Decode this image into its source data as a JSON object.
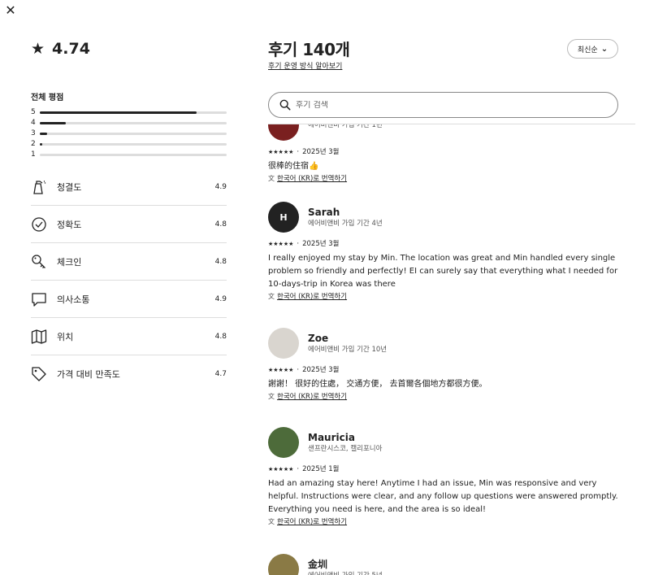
{
  "close_icon": "close-icon",
  "summary": {
    "score": "4.74",
    "overall_label": "전체 평점",
    "distribution": [
      {
        "stars": "5",
        "fraction": 0.84
      },
      {
        "stars": "4",
        "fraction": 0.14
      },
      {
        "stars": "3",
        "fraction": 0.04
      },
      {
        "stars": "2",
        "fraction": 0.01
      },
      {
        "stars": "1",
        "fraction": 0.0
      }
    ],
    "categories": [
      {
        "icon": "cleaning-spray-icon",
        "label": "청결도",
        "value": "4.9"
      },
      {
        "icon": "check-circle-icon",
        "label": "정확도",
        "value": "4.8"
      },
      {
        "icon": "key-icon",
        "label": "체크인",
        "value": "4.8"
      },
      {
        "icon": "chat-bubble-icon",
        "label": "의사소통",
        "value": "4.9"
      },
      {
        "icon": "map-icon",
        "label": "위치",
        "value": "4.8"
      },
      {
        "icon": "price-tag-icon",
        "label": "가격 대비 만족도",
        "value": "4.7"
      }
    ]
  },
  "header": {
    "title": "후기 140개",
    "how_link": "후기 운영 방식 알아보기",
    "sort_label": "최신순"
  },
  "search": {
    "placeholder": "후기 검색"
  },
  "translate_label": "한국어 (KR)로 번역하기",
  "stars_glyph": "★★★★★",
  "reviews": [
    {
      "name": "",
      "subtitle": "에어비앤비 가입 기간 1년",
      "date": "2025년 3월",
      "text": "很棒的住宿👍",
      "avatar_color": "#7a2020",
      "avatar_initial": ""
    },
    {
      "name": "Sarah",
      "subtitle": "에어비앤비 가입 기간 4년",
      "date": "2025년 3월",
      "text": "I really enjoyed my stay by Min. The location was great and Min handled every single problem so friendly and perfectly! EI can surely say that everything what I needed for 10-days-trip in Korea was there",
      "avatar_color": "#222222",
      "avatar_initial": "H"
    },
    {
      "name": "Zoe",
      "subtitle": "에어비앤비 가입 기간 10년",
      "date": "2025년 3월",
      "text": "謝謝！ 很好的住處， 交通方便， 去首爾各個地方都很方便。",
      "avatar_color": "#d9d5cf",
      "avatar_initial": ""
    },
    {
      "name": "Mauricia",
      "subtitle": "샌프란시스코, 캘리포니아",
      "date": "2025년 1월",
      "text": "Had an amazing stay here! Anytime I had an issue, Min was responsive and very helpful. Instructions were clear, and any follow up questions were answered promptly. Everything you need is here, and the area is so ideal!",
      "avatar_color": "#4d6b3a",
      "avatar_initial": ""
    },
    {
      "name": "金圳",
      "subtitle": "에어비앤비 가입 기간 5년",
      "date": "",
      "text": "",
      "avatar_color": "#8a7a45",
      "avatar_initial": ""
    }
  ]
}
